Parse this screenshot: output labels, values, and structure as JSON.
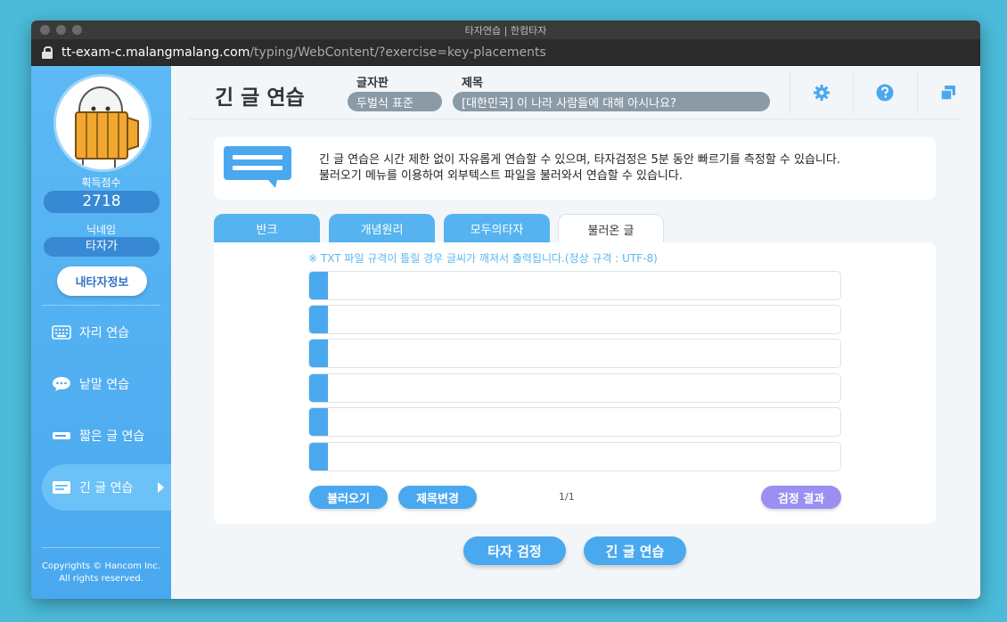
{
  "window": {
    "title": "타자연습 | 한컴타자"
  },
  "url": {
    "host": "tt-exam-c.malangmalang.com",
    "path": "/typing/WebContent/?exercise=key-placements"
  },
  "sidebar": {
    "score_label": "획득점수",
    "score_value": "2718",
    "nickname_label": "닉네임",
    "nickname_value": "타자가",
    "my_info_label": "내타자정보",
    "items": [
      {
        "label": "자리 연습",
        "icon": "keyboard-icon"
      },
      {
        "label": "낱말 연습",
        "icon": "speech-bubble-icon"
      },
      {
        "label": "짧은 글 연습",
        "icon": "short-line-icon"
      },
      {
        "label": "긴 글 연습",
        "icon": "long-text-icon",
        "active": true
      }
    ],
    "copyright_line1": "Copyrights © Hancom Inc.",
    "copyright_line2": "All rights reserved."
  },
  "header": {
    "title": "긴 글 연습",
    "keyboard_label": "글자판",
    "keyboard_value": "두벌식 표준",
    "subject_label": "제목",
    "subject_value": "[대한민국] 이 나라 사람들에 대해 아시나요?",
    "icons": [
      "gear-icon",
      "help-icon",
      "window-icon"
    ]
  },
  "info": {
    "line1": "긴 글 연습은 시간 제한 없이 자유롭게 연습할 수 있으며, 타자검정은 5분 동안 빠르기를 측정할 수 있습니다.",
    "line2": "불러오기 메뉴를 이용하여 외부텍스트 파일을 불러와서 연습할 수 있습니다."
  },
  "tabs": [
    {
      "label": "반크"
    },
    {
      "label": "개념원리"
    },
    {
      "label": "모두의타자"
    },
    {
      "label": "불러온 글",
      "active": true
    }
  ],
  "panel": {
    "notice": "※ TXT 파일 규격이 틀릴 경우 글씨가 깨져서 출력됩니다.(정상 규격 : UTF-8)",
    "lines": [
      "",
      "",
      "",
      "",
      "",
      ""
    ],
    "load_label": "불러오기",
    "rename_label": "제목변경",
    "pager": "1/1",
    "result_label": "검정 결과"
  },
  "bottom": {
    "test_label": "타자 검정",
    "practice_label": "긴 글 연습"
  },
  "colors": {
    "sidebar": "#4aa8ef",
    "accent": "#4aa8ef",
    "result_button": "#9b8ff2",
    "background": "#4bbbd9"
  }
}
